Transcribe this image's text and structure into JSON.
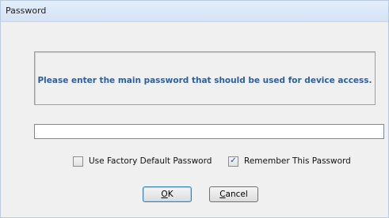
{
  "window": {
    "title": "Password"
  },
  "message": "Please enter the main password that should be used for device access.",
  "password_field": {
    "value": "",
    "placeholder": ""
  },
  "checkboxes": [
    {
      "label": "Use Factory Default Password",
      "checked": false
    },
    {
      "label": "Remember This Password",
      "checked": true
    }
  ],
  "buttons": {
    "ok": {
      "mnemonic": "O",
      "rest": "K"
    },
    "cancel": {
      "mnemonic": "C",
      "rest": "ancel"
    }
  },
  "colors": {
    "message": "#2a5fa8",
    "titlebar": "#dbe7f6",
    "dialog_bg": "#f0f0f0"
  }
}
